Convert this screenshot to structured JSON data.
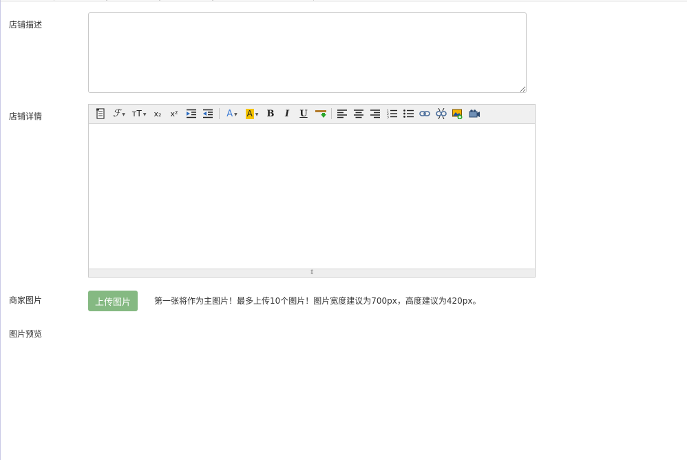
{
  "labels": {
    "store_description": "店铺描述",
    "store_details": "店铺详情",
    "merchant_images": "商家图片",
    "image_preview": "图片预览"
  },
  "description": {
    "value": ""
  },
  "editor": {
    "toolbar": [
      "source-icon",
      "font-family-icon",
      "font-size-icon",
      "subscript-icon",
      "superscript-icon",
      "indent-icon",
      "outdent-icon",
      "font-color-icon",
      "highlight-color-icon",
      "bold-icon",
      "italic-icon",
      "underline-icon",
      "insert-horizontal-rule-icon",
      "align-left-icon",
      "align-center-icon",
      "align-right-icon",
      "ordered-list-icon",
      "unordered-list-icon",
      "link-icon",
      "unlink-icon",
      "insert-image-icon",
      "insert-video-icon"
    ],
    "glyphs": {
      "font_family": "ℱ",
      "font_size": "ᴛT",
      "subscript": "x₂",
      "superscript": "x²",
      "font_color": "A",
      "highlight": "A",
      "bold": "B",
      "italic": "I",
      "underline": "U"
    },
    "colors": {
      "font_color": "#3d7bd6",
      "highlight": "#f5c400"
    },
    "content": ""
  },
  "upload": {
    "button_label": "上传图片",
    "hint": "第一张将作为主图片！最多上传10个图片！图片宽度建议为700px，高度建议为420px。"
  },
  "accent_color": "#85b982"
}
